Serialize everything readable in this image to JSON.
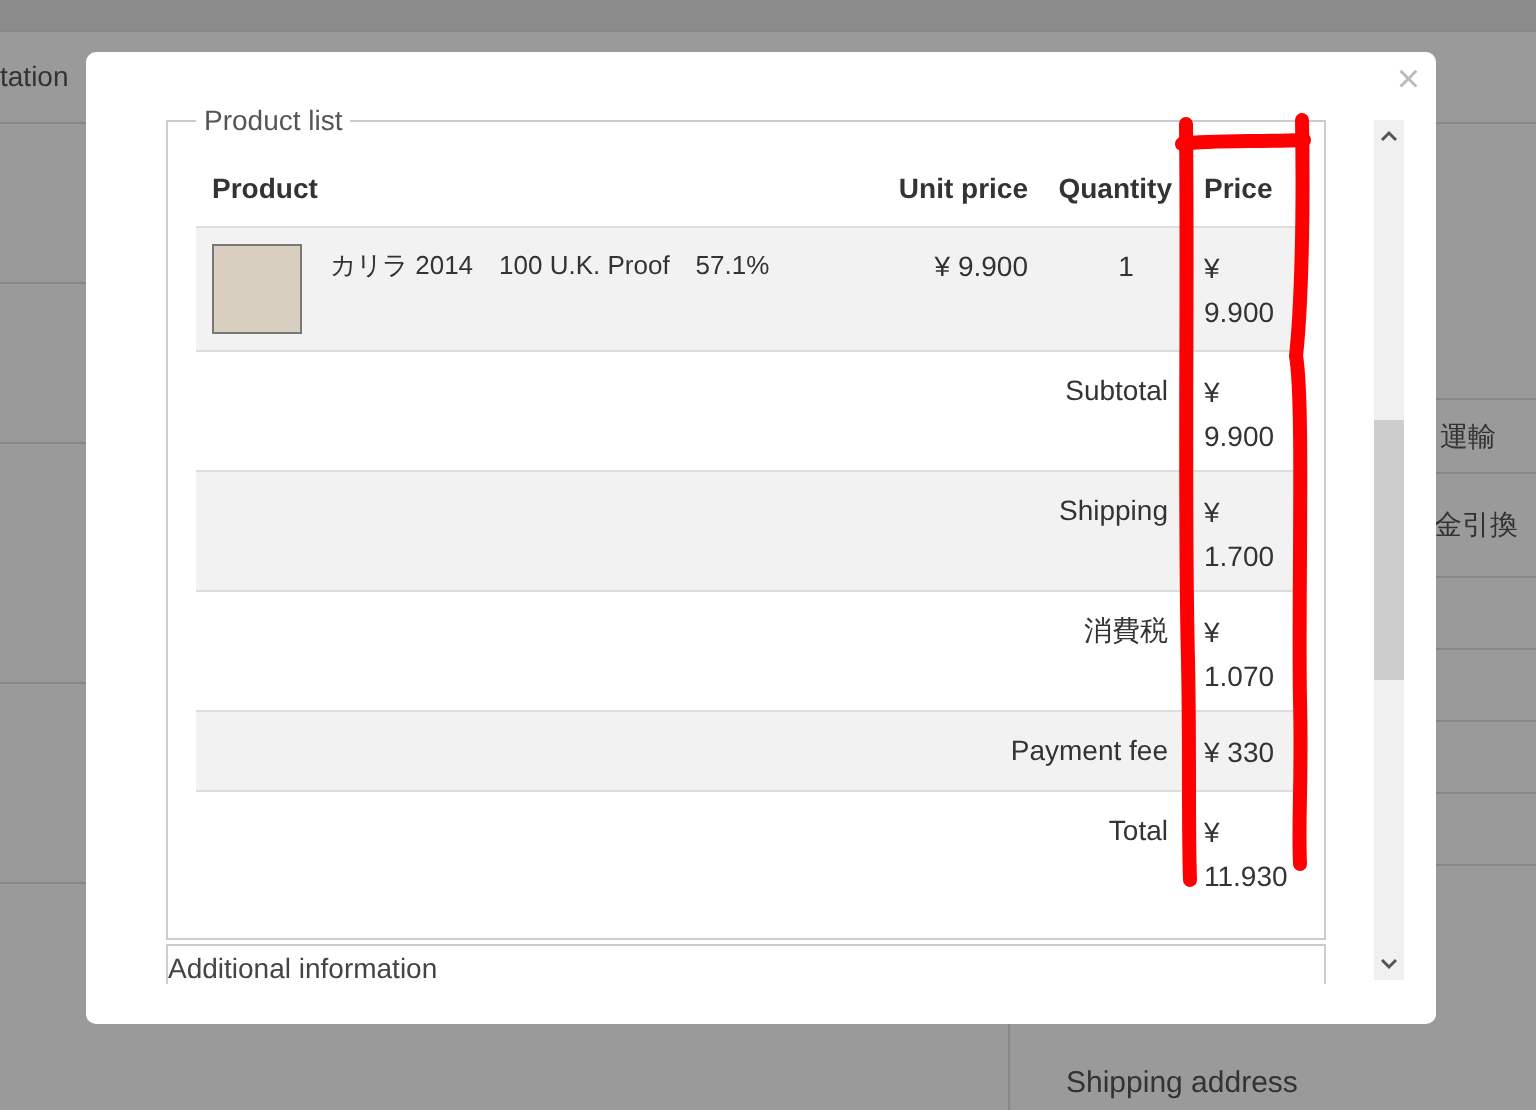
{
  "background": {
    "top_tab": "tation",
    "side_texts": [
      "運輸",
      "金引換"
    ],
    "shipping_address": "Shipping address"
  },
  "modal": {
    "close": "×",
    "product_list": {
      "legend": "Product list",
      "columns": [
        "Product",
        "Unit price",
        "Quantity",
        "Price"
      ],
      "items": [
        {
          "name": "カリラ 2014　100 U.K. Proof　57.1%",
          "unit_price": "¥ 9.900",
          "quantity": "1",
          "price": "¥ 9.900"
        }
      ],
      "summary": [
        {
          "label": "Subtotal",
          "value": "¥ 9.900"
        },
        {
          "label": "Shipping",
          "value": "¥ 1.700"
        },
        {
          "label": "消費税",
          "value": "¥ 1.070"
        },
        {
          "label": "Payment fee",
          "value": "¥ 330"
        },
        {
          "label": "Total",
          "value": "¥ 11.930"
        }
      ]
    },
    "next_section": "Additional information"
  }
}
